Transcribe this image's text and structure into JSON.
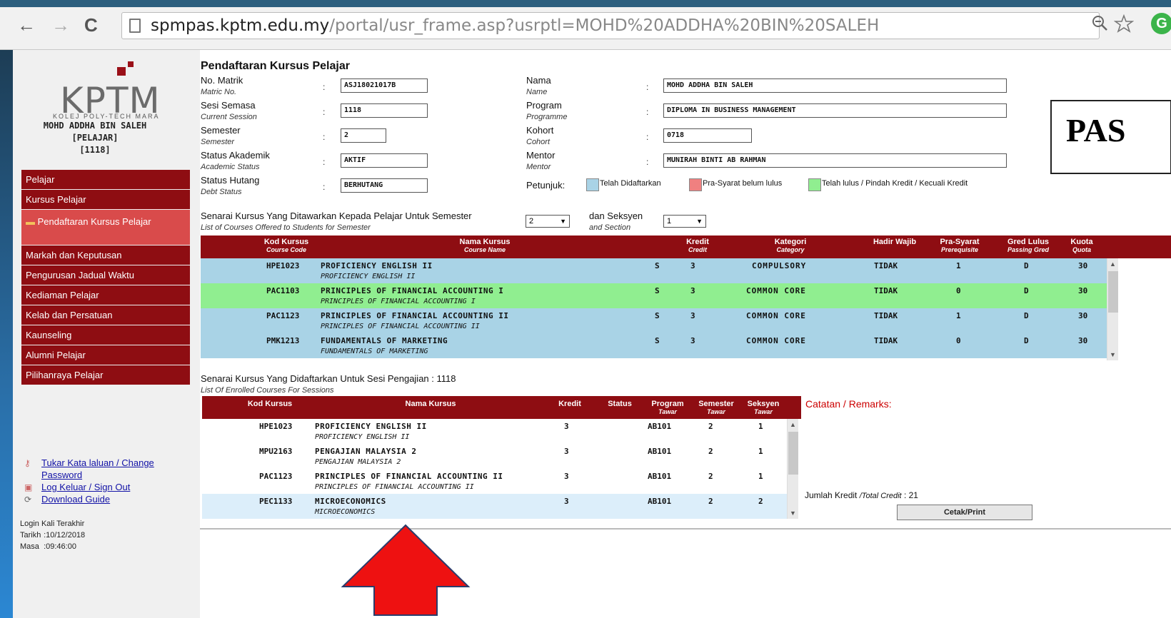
{
  "browser": {
    "back_icon": "←",
    "forward_icon": "→",
    "reload_icon": "C",
    "url_host": "spmpas.kptm.edu.my",
    "url_path": "/portal/usr_frame.asp?usrptl=MOHD%20ADDHA%20BIN%20SALEH",
    "extension_letter": "G"
  },
  "sidebar": {
    "logo_text": "KPTM",
    "logo_sub": "KOLEJ POLY-TECH MARA",
    "user_name": "MOHD ADDHA BIN SALEH",
    "user_role": "[PELAJAR]",
    "user_session": "[1118]",
    "menu": [
      "Pelajar",
      "Kursus Pelajar",
      "Pendaftaran Kursus Pelajar",
      "Markah dan Keputusan",
      "Pengurusan Jadual Waktu",
      "Kediaman Pelajar",
      "Kelab dan Persatuan",
      "Kaunseling",
      "Alumni Pelajar",
      "Pilihanraya Pelajar"
    ],
    "links": {
      "change_password_1": "Tukar Kata laluan / Change",
      "change_password_2": "Password",
      "logout": "Log Keluar / Sign Out",
      "download": "Download Guide"
    },
    "login": {
      "heading": "Login Kali Terakhir",
      "date_label": "Tarikh",
      "date_value": ":10/12/2018",
      "time_label": "Masa",
      "time_value": ":09:46:00"
    }
  },
  "form": {
    "title": "Pendaftaran Kursus Pelajar",
    "matrik_label": "No. Matrik",
    "matrik_sub": "Matric No.",
    "matrik_value": "ASJ18021017B",
    "sesi_label": "Sesi Semasa",
    "sesi_sub": "Current Session",
    "sesi_value": "1118",
    "semester_label": "Semester",
    "semester_sub": "Semester",
    "semester_value": "2",
    "akademik_label": "Status Akademik",
    "akademik_sub": "Academic Status",
    "akademik_value": "AKTIF",
    "hutang_label": "Status Hutang",
    "hutang_sub": "Debt Status",
    "hutang_value": "BERHUTANG",
    "nama_label": "Nama",
    "nama_sub": "Name",
    "nama_value": "MOHD ADDHA BIN SALEH",
    "program_label": "Program",
    "program_sub": "Programme",
    "program_value": "DIPLOMA IN BUSINESS MANAGEMENT",
    "kohort_label": "Kohort",
    "kohort_sub": "Cohort",
    "kohort_value": "0718",
    "mentor_label": "Mentor",
    "mentor_sub": "Mentor",
    "mentor_value": "MUNIRAH BINTI AB RAHMAN",
    "colon": ":",
    "petunjuk_label": "Petunjuk:",
    "legend": [
      {
        "label": "Telah Didaftarkan",
        "color": "#a9d3e6"
      },
      {
        "label": "Pra-Syarat belum lulus",
        "color": "#f08080"
      },
      {
        "label": "Telah lulus / Pindah Kredit / Kecuali Kredit",
        "color": "#90ee90"
      }
    ],
    "pas_text": "PAS"
  },
  "offered": {
    "heading": "Senarai Kursus Yang Ditawarkan Kepada Pelajar Untuk Semester",
    "heading_sub": "List of Courses Offered to Students for Semester",
    "semester_select": "2",
    "section_label": "dan Seksyen",
    "section_sub": "and Section",
    "section_select": "1",
    "headers": {
      "code": "Kod Kursus",
      "code_sub": "Course Code",
      "name": "Nama Kursus",
      "name_sub": "Course Name",
      "credit": "Kredit",
      "credit_sub": "Credit",
      "category": "Kategori",
      "category_sub": "Category",
      "mandatory": "Hadir Wajib",
      "prereq": "Pra-Syarat",
      "prereq_sub": "Prerequisite",
      "grade": "Gred Lulus",
      "grade_sub": "Passing Gred",
      "quota": "Kuota",
      "quota_sub": "Quota"
    },
    "rows": [
      {
        "code": "HPE1023",
        "name": "PROFICIENCY ENGLISH II",
        "name_sub": "PROFICIENCY ENGLISH II",
        "s": "S",
        "credit": "3",
        "category": "COMPULSORY",
        "mandatory": "TIDAK",
        "prereq": "1",
        "grade": "D",
        "quota": "30",
        "color": "#a9d3e6"
      },
      {
        "code": "PAC1103",
        "name": "PRINCIPLES OF FINANCIAL ACCOUNTING I",
        "name_sub": "PRINCIPLES OF FINANCIAL ACCOUNTING I",
        "s": "S",
        "credit": "3",
        "category": "COMMON CORE",
        "mandatory": "TIDAK",
        "prereq": "0",
        "grade": "D",
        "quota": "30",
        "color": "#90ee90"
      },
      {
        "code": "PAC1123",
        "name": "PRINCIPLES OF FINANCIAL ACCOUNTING II",
        "name_sub": "PRINCIPLES OF FINANCIAL ACCOUNTING II",
        "s": "S",
        "credit": "3",
        "category": "COMMON CORE",
        "mandatory": "TIDAK",
        "prereq": "1",
        "grade": "D",
        "quota": "30",
        "color": "#a9d3e6"
      },
      {
        "code": "PMK1213",
        "name": "FUNDAMENTALS OF MARKETING",
        "name_sub": "FUNDAMENTALS OF MARKETING",
        "s": "S",
        "credit": "3",
        "category": "COMMON CORE",
        "mandatory": "TIDAK",
        "prereq": "0",
        "grade": "D",
        "quota": "30",
        "color": "#a9d3e6"
      }
    ]
  },
  "enrolled": {
    "heading": "Senarai Kursus Yang Didaftarkan Untuk Sesi Pengajian : 1118",
    "heading_sub": "List Of Enrolled Courses For Sessions",
    "headers": {
      "code": "Kod Kursus",
      "name": "Nama Kursus",
      "credit": "Kredit",
      "status": "Status",
      "program": "Program",
      "program_sub": "Tawar",
      "semester": "Semester",
      "semester_sub": "Tawar",
      "section": "Seksyen",
      "section_sub": "Tawar"
    },
    "rows": [
      {
        "code": "HPE1023",
        "name": "PROFICIENCY ENGLISH II",
        "name_sub": "PROFICIENCY ENGLISH II",
        "credit": "3",
        "program": "AB101",
        "semester": "2",
        "section": "1",
        "color": "#ffffff"
      },
      {
        "code": "MPU2163",
        "name": "PENGAJIAN MALAYSIA 2",
        "name_sub": "PENGAJIAN MALAYSIA 2",
        "credit": "3",
        "program": "AB101",
        "semester": "2",
        "section": "1",
        "color": "#ffffff"
      },
      {
        "code": "PAC1123",
        "name": "PRINCIPLES OF FINANCIAL ACCOUNTING II",
        "name_sub": "PRINCIPLES OF FINANCIAL ACCOUNTING II",
        "credit": "3",
        "program": "AB101",
        "semester": "2",
        "section": "1",
        "color": "#ffffff"
      },
      {
        "code": "PEC1133",
        "name": "MICROECONOMICS",
        "name_sub": "MICROECONOMICS",
        "credit": "3",
        "program": "AB101",
        "semester": "2",
        "section": "2",
        "color": "#dceefa"
      }
    ],
    "remarks": "Catatan / Remarks:",
    "total_label": "Jumlah Kredit",
    "total_sub": "/Total Credit",
    "total_value": ":  21",
    "print": "Cetak/Print"
  }
}
